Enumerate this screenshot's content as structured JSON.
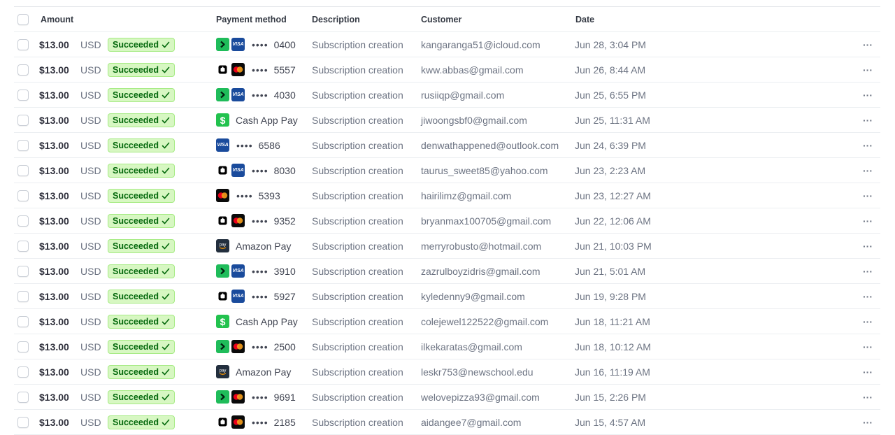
{
  "columns": {
    "amount": "Amount",
    "payment_method": "Payment method",
    "description": "Description",
    "customer": "Customer",
    "date": "Date"
  },
  "status_label": "Succeeded",
  "more_label": "···",
  "colors": {
    "badge_bg": "#d7f7c2",
    "badge_text": "#05690d",
    "link_green": "#1fbc5a",
    "visa_blue": "#1a4b9c",
    "cashapp_green": "#22c24e"
  },
  "rows": [
    {
      "amount": "$13.00",
      "currency": "USD",
      "pm": {
        "icons": [
          "link-icon",
          "visa-icon"
        ],
        "dots": "••••",
        "last4": "0400"
      },
      "description": "Subscription creation",
      "customer": "kangaranga51@icloud.com",
      "date": "Jun 28, 3:04 PM"
    },
    {
      "amount": "$13.00",
      "currency": "USD",
      "pm": {
        "icons": [
          "apple-pay-icon",
          "mastercard-icon"
        ],
        "dots": "••••",
        "last4": "5557"
      },
      "description": "Subscription creation",
      "customer": "kww.abbas@gmail.com",
      "date": "Jun 26, 8:44 AM"
    },
    {
      "amount": "$13.00",
      "currency": "USD",
      "pm": {
        "icons": [
          "link-icon",
          "visa-icon"
        ],
        "dots": "••••",
        "last4": "4030"
      },
      "description": "Subscription creation",
      "customer": "rusiiqp@gmail.com",
      "date": "Jun 25, 6:55 PM"
    },
    {
      "amount": "$13.00",
      "currency": "USD",
      "pm": {
        "icons": [
          "cash-app-icon"
        ],
        "text": "Cash App Pay"
      },
      "description": "Subscription creation",
      "customer": "jiwoongsbf0@gmail.com",
      "date": "Jun 25, 11:31 AM"
    },
    {
      "amount": "$13.00",
      "currency": "USD",
      "pm": {
        "icons": [
          "visa-icon"
        ],
        "dots": "••••",
        "last4": "6586"
      },
      "description": "Subscription creation",
      "customer": "denwathappened@outlook.com",
      "date": "Jun 24, 6:39 PM"
    },
    {
      "amount": "$13.00",
      "currency": "USD",
      "pm": {
        "icons": [
          "apple-pay-icon",
          "visa-icon"
        ],
        "dots": "••••",
        "last4": "8030"
      },
      "description": "Subscription creation",
      "customer": "taurus_sweet85@yahoo.com",
      "date": "Jun 23, 2:23 AM"
    },
    {
      "amount": "$13.00",
      "currency": "USD",
      "pm": {
        "icons": [
          "mastercard-icon"
        ],
        "dots": "••••",
        "last4": "5393"
      },
      "description": "Subscription creation",
      "customer": "hairilimz@gmail.com",
      "date": "Jun 23, 12:27 AM"
    },
    {
      "amount": "$13.00",
      "currency": "USD",
      "pm": {
        "icons": [
          "apple-pay-icon",
          "mastercard-icon"
        ],
        "dots": "••••",
        "last4": "9352"
      },
      "description": "Subscription creation",
      "customer": "bryanmax100705@gmail.com",
      "date": "Jun 22, 12:06 AM"
    },
    {
      "amount": "$13.00",
      "currency": "USD",
      "pm": {
        "icons": [
          "amazon-pay-icon"
        ],
        "text": "Amazon Pay"
      },
      "description": "Subscription creation",
      "customer": "merryrobusto@hotmail.com",
      "date": "Jun 21, 10:03 PM"
    },
    {
      "amount": "$13.00",
      "currency": "USD",
      "pm": {
        "icons": [
          "link-icon",
          "visa-icon"
        ],
        "dots": "••••",
        "last4": "3910"
      },
      "description": "Subscription creation",
      "customer": "zazrulboyzidris@gmail.com",
      "date": "Jun 21, 5:01 AM"
    },
    {
      "amount": "$13.00",
      "currency": "USD",
      "pm": {
        "icons": [
          "apple-pay-icon",
          "visa-icon"
        ],
        "dots": "••••",
        "last4": "5927"
      },
      "description": "Subscription creation",
      "customer": "kyledenny9@gmail.com",
      "date": "Jun 19, 9:28 PM"
    },
    {
      "amount": "$13.00",
      "currency": "USD",
      "pm": {
        "icons": [
          "cash-app-icon"
        ],
        "text": "Cash App Pay"
      },
      "description": "Subscription creation",
      "customer": "colejewel122522@gmail.com",
      "date": "Jun 18, 11:21 AM"
    },
    {
      "amount": "$13.00",
      "currency": "USD",
      "pm": {
        "icons": [
          "link-icon",
          "mastercard-icon"
        ],
        "dots": "••••",
        "last4": "2500"
      },
      "description": "Subscription creation",
      "customer": "ilkekaratas@gmail.com",
      "date": "Jun 18, 10:12 AM"
    },
    {
      "amount": "$13.00",
      "currency": "USD",
      "pm": {
        "icons": [
          "amazon-pay-icon"
        ],
        "text": "Amazon Pay"
      },
      "description": "Subscription creation",
      "customer": "leskr753@newschool.edu",
      "date": "Jun 16, 11:19 AM"
    },
    {
      "amount": "$13.00",
      "currency": "USD",
      "pm": {
        "icons": [
          "link-icon",
          "mastercard-icon"
        ],
        "dots": "••••",
        "last4": "9691"
      },
      "description": "Subscription creation",
      "customer": "welovepizza93@gmail.com",
      "date": "Jun 15, 2:26 PM"
    },
    {
      "amount": "$13.00",
      "currency": "USD",
      "pm": {
        "icons": [
          "apple-pay-icon",
          "mastercard-icon"
        ],
        "dots": "••••",
        "last4": "2185"
      },
      "description": "Subscription creation",
      "customer": "aidangee7@gmail.com",
      "date": "Jun 15, 4:57 AM"
    }
  ]
}
